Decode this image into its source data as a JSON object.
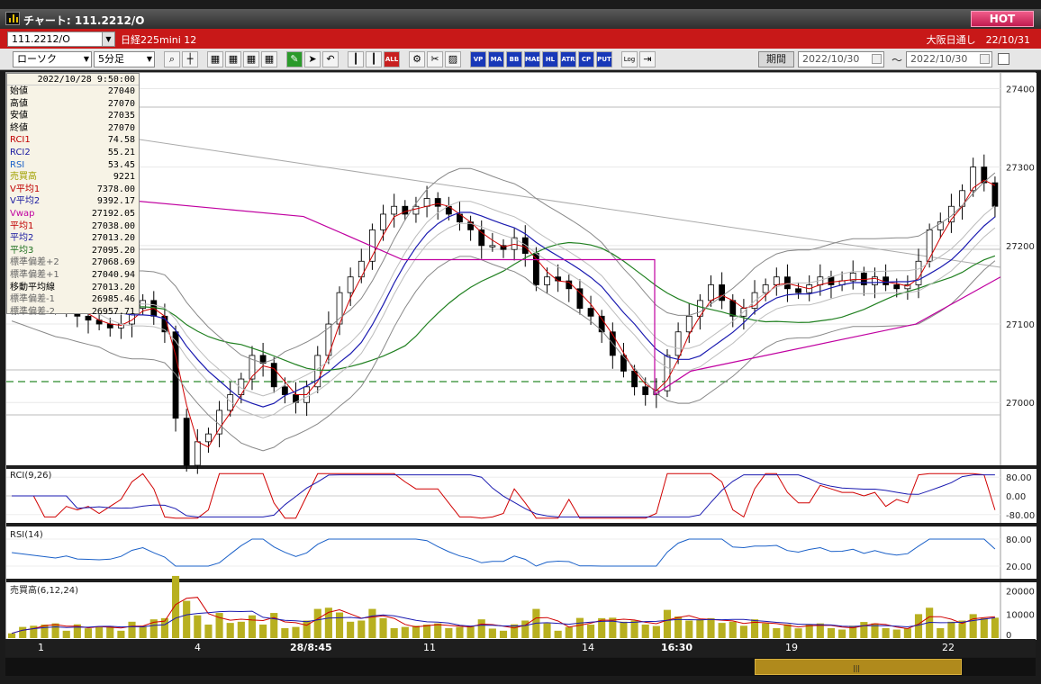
{
  "title": "チャート: 111.2212/O",
  "hot_label": "HOT",
  "symbol": "111.2212/O",
  "instrument": "日経225mini 12",
  "session": "大阪日通し　22/10/31",
  "chart_type": "ローソク",
  "interval": "5分足",
  "period_label": "期間",
  "date_from": "2022/10/30",
  "date_to": "2022/10/30",
  "tilde": "〜",
  "toolbar_icons": [
    "search-icon",
    "crosshair-icon",
    "tool-icon",
    "tool-icon",
    "tool-icon",
    "tool-icon",
    "pen-icon",
    "cursor-icon",
    "undo-icon",
    "candle-icon",
    "candle-icon",
    "all-icon",
    "settings-icon",
    "wrench-icon",
    "color-icon",
    "vp-icon",
    "ma-icon",
    "bb-icon",
    "mae-icon",
    "hl-icon",
    "atr-icon",
    "cp-icon",
    "put-icon",
    "log-icon",
    "export-icon"
  ],
  "toolbar_labels": {
    "all": "ALL",
    "vp": "VP",
    "ma": "MA",
    "bb": "BB",
    "mae": "MAE",
    "hl": "HL",
    "atr": "ATR",
    "cp": "CP",
    "put": "PUT",
    "log": "Log"
  },
  "info": {
    "datetime": "2022/10/28  9:50:00",
    "rows": [
      {
        "k": "始値",
        "v": "27040",
        "c": "#000"
      },
      {
        "k": "高値",
        "v": "27070",
        "c": "#000"
      },
      {
        "k": "安値",
        "v": "27035",
        "c": "#000"
      },
      {
        "k": "終値",
        "v": "27070",
        "c": "#000"
      },
      {
        "k": "RCI1",
        "v": "74.58",
        "c": "#c00000"
      },
      {
        "k": "RCI2",
        "v": "55.21",
        "c": "#1a1aa0"
      },
      {
        "k": "RSI",
        "v": "53.45",
        "c": "#1a60c8"
      },
      {
        "k": "売買高",
        "v": "9221",
        "c": "#a0a000"
      },
      {
        "k": "V平均1",
        "v": "7378.00",
        "c": "#c00000"
      },
      {
        "k": "V平均2",
        "v": "9392.17",
        "c": "#1a1aa0"
      },
      {
        "k": "Vwap",
        "v": "27192.05",
        "c": "#c000a0"
      },
      {
        "k": "平均1",
        "v": "27038.00",
        "c": "#c00000"
      },
      {
        "k": "平均2",
        "v": "27013.20",
        "c": "#1a1aa0"
      },
      {
        "k": "平均3",
        "v": "27095.20",
        "c": "#207020"
      },
      {
        "k": "標準偏差+2",
        "v": "27068.69",
        "c": "#666"
      },
      {
        "k": "標準偏差+1",
        "v": "27040.94",
        "c": "#666"
      },
      {
        "k": "移動平均線",
        "v": "27013.20",
        "c": "#000"
      },
      {
        "k": "標準偏差-1",
        "v": "26985.46",
        "c": "#666"
      },
      {
        "k": "標準偏差-2",
        "v": "26957.71",
        "c": "#666"
      }
    ]
  },
  "price_axis": [
    "27400",
    "27300",
    "27200",
    "27100",
    "27000"
  ],
  "rci_label": "RCI(9,26)",
  "rci_axis": [
    "80.00",
    "0.00",
    "-80.00"
  ],
  "rsi_label": "RSI(14)",
  "rsi_axis": [
    "80.00",
    "20.00"
  ],
  "vol_label": "売買高(6,12,24)",
  "vol_axis": [
    "20000",
    "10000",
    "0"
  ],
  "x_labels": [
    "1",
    "4",
    "28/8:45",
    "11",
    "14",
    "16:30",
    "19",
    "22"
  ],
  "chart_data": {
    "type": "candlestick",
    "price_range": [
      26920,
      27420
    ],
    "closes": [
      27160,
      27150,
      27140,
      27130,
      27120,
      27125,
      27110,
      27105,
      27100,
      27095,
      27100,
      27120,
      27130,
      27110,
      27090,
      26980,
      26920,
      26950,
      26960,
      26990,
      27010,
      27030,
      27060,
      27050,
      27020,
      27010,
      27000,
      27020,
      27060,
      27100,
      27140,
      27160,
      27180,
      27220,
      27240,
      27250,
      27240,
      27250,
      27260,
      27250,
      27240,
      27230,
      27220,
      27200,
      27200,
      27195,
      27210,
      27190,
      27150,
      27160,
      27155,
      27145,
      27120,
      27110,
      27090,
      27060,
      27040,
      27020,
      27010,
      27015,
      27060,
      27090,
      27110,
      27130,
      27150,
      27130,
      27110,
      27120,
      27140,
      27150,
      27160,
      27145,
      27140,
      27150,
      27160,
      27150,
      27155,
      27165,
      27150,
      27160,
      27150,
      27145,
      27150,
      27180,
      27220,
      27230,
      27250,
      27270,
      27300,
      27280,
      27250
    ],
    "vwap": 27192.05,
    "rci": {
      "rci1": 74.58,
      "rci2": 55.21
    },
    "rsi": 53.45,
    "volume": 9221
  }
}
